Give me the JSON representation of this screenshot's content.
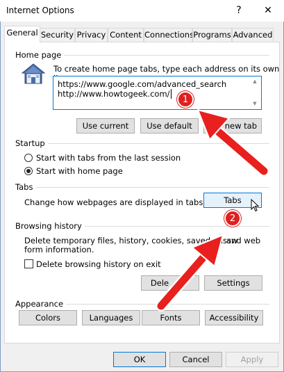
{
  "window": {
    "title": "Internet Options",
    "help_glyph": "?",
    "close_glyph": "✕"
  },
  "tabs": [
    {
      "label": "General",
      "active": true
    },
    {
      "label": "Security"
    },
    {
      "label": "Privacy"
    },
    {
      "label": "Content"
    },
    {
      "label": "Connections"
    },
    {
      "label": "Programs"
    },
    {
      "label": "Advanced"
    }
  ],
  "home_page": {
    "section_label": "Home page",
    "instruction": "To create home page tabs, type each address on its own line.",
    "urls": [
      "https://www.google.com/advanced_search",
      "http://www.howtogeek.com/"
    ],
    "buttons": {
      "use_current": "Use current",
      "use_default": "Use default",
      "use_new_tab": "new tab"
    }
  },
  "startup": {
    "section_label": "Startup",
    "option_last_session": "Start with tabs from the last session",
    "option_home_page": "Start with home page",
    "selected": "home_page"
  },
  "tabs_section": {
    "section_label": "Tabs",
    "description": "Change how webpages are displayed in tabs.",
    "button": "Tabs"
  },
  "browsing_history": {
    "section_label": "Browsing history",
    "description_line1": "Delete temporary files, history, cookies, saved passw",
    "description_line1_end": "and web",
    "description_line2": "form information.",
    "checkbox_label": "Delete browsing history on exit",
    "checkbox_checked": false,
    "buttons": {
      "delete": "Dele",
      "settings": "Settings"
    }
  },
  "appearance": {
    "section_label": "Appearance",
    "buttons": {
      "colors": "Colors",
      "languages": "Languages",
      "fonts": "Fonts",
      "accessibility": "Accessibility"
    }
  },
  "footer": {
    "ok": "OK",
    "cancel": "Cancel",
    "apply": "Apply"
  },
  "annotations": {
    "badge1": "1",
    "badge2": "2",
    "arrow_color": "#e8201e"
  }
}
